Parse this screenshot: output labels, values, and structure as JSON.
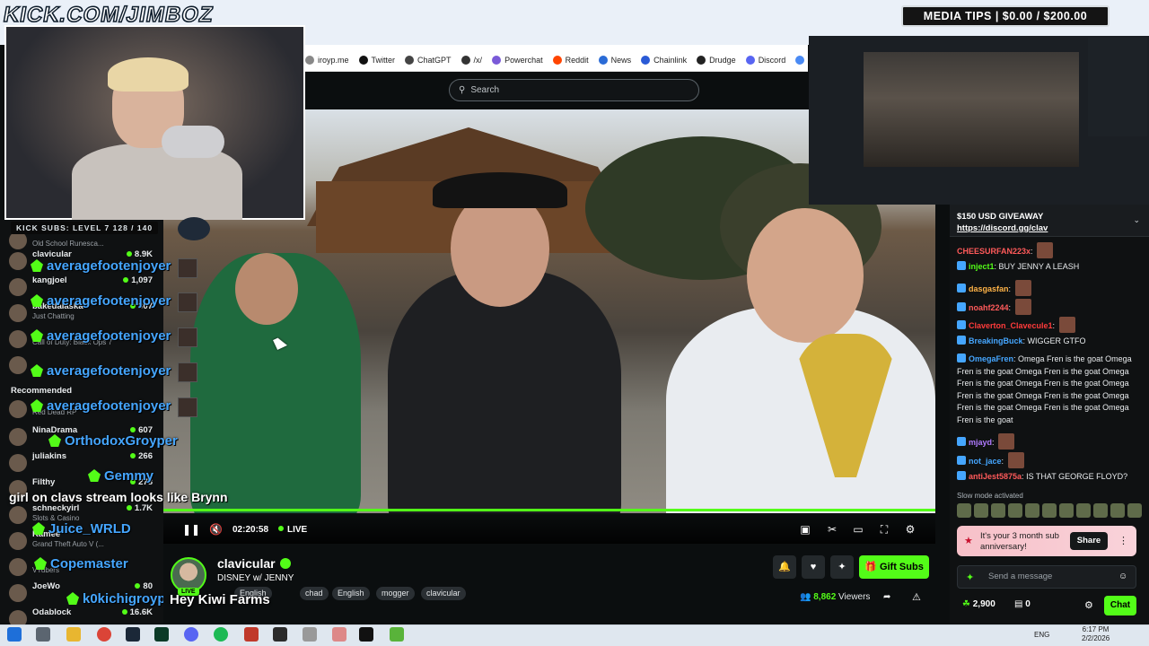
{
  "overlay": {
    "title": "KICK.COM/JIMBOZ",
    "subs_bar": "KICK SUBS: LEVEL 7 128 / 140",
    "media_tips": "MEDIA TIPS | $0.00 / $200.00",
    "caption": "girl on clavs stream looks like Brynn",
    "hey": "Hey Kiwi Farms",
    "chat_users": [
      "averagefootenjoyer",
      "averagefootenjoyer",
      "averagefootenjoyer",
      "averagefootenjoyer",
      "averagefootenjoyer",
      "OrthodoxGroyper",
      "Gemmy",
      "Juice_WRLD",
      "Copemaster",
      "k0kichigroyper"
    ]
  },
  "browser": {
    "bookmarks": [
      {
        "label": "iroyp.me",
        "color": "#888888"
      },
      {
        "label": "Twitter",
        "color": "#111111"
      },
      {
        "label": "ChatGPT",
        "color": "#444444"
      },
      {
        "label": "/x/",
        "color": "#333333"
      },
      {
        "label": "Powerchat",
        "color": "#7a5ad8"
      },
      {
        "label": "Reddit",
        "color": "#ff4500"
      },
      {
        "label": "News",
        "color": "#2a6bd6"
      },
      {
        "label": "Chainlink",
        "color": "#2a5ad6"
      },
      {
        "label": "Drudge",
        "color": "#222222"
      },
      {
        "label": "Discord",
        "color": "#5865f2"
      },
      {
        "label": "Gemini",
        "color": "#4a8af4"
      }
    ]
  },
  "search": {
    "placeholder": "Search"
  },
  "sidebar": {
    "recommended_label": "Recommended",
    "channels": [
      {
        "name": "",
        "game": "Old School Runesca...",
        "viewers": ""
      },
      {
        "name": "clavicular",
        "game": "",
        "viewers": "8.9K"
      },
      {
        "name": "kangjoel",
        "game": "",
        "viewers": "1,097"
      },
      {
        "name": "bakedalaska",
        "game": "Just Chatting",
        "viewers": "307"
      },
      {
        "name": "",
        "game": "Call of Duty: Black Ops 7",
        "viewers": ""
      },
      {
        "name": "",
        "game": "",
        "viewers": ""
      },
      {
        "name": "",
        "game": "Red Dead RP",
        "viewers": ""
      },
      {
        "name": "NinaDrama",
        "game": "",
        "viewers": "607"
      },
      {
        "name": "juliakins",
        "game": "",
        "viewers": "266"
      },
      {
        "name": "Filthy",
        "game": "",
        "viewers": "278"
      },
      {
        "name": "schneckyirl",
        "game": "Slots & Casino",
        "viewers": "1.7K"
      },
      {
        "name": "Ramee",
        "game": "Grand Theft Auto V (...",
        "viewers": ""
      },
      {
        "name": "",
        "game": "VTubers",
        "viewers": ""
      },
      {
        "name": "JoeWo",
        "game": "",
        "viewers": "80"
      },
      {
        "name": "Odablock",
        "game": "",
        "viewers": "16.6K"
      }
    ]
  },
  "player": {
    "time": "02:20:58",
    "live_label": "LIVE",
    "progress": 1.0
  },
  "stream": {
    "live_pill": "LIVE",
    "streamer": "clavicular",
    "title": "DISNEY w/ JENNY",
    "tags": [
      "English",
      "chad",
      "English",
      "mogger",
      "clavicular"
    ],
    "viewers_count": "8,862",
    "viewers_label": "Viewers",
    "gift_label": "Gift Subs"
  },
  "chat": {
    "giveaway_title": "$150 USD GIVEAWAY",
    "giveaway_link": "https://discord.gg/clav",
    "messages": [
      {
        "user": "CHEESURFAN223x",
        "color": "#ff5a5a",
        "text": "",
        "emote": true
      },
      {
        "user": "inject1",
        "color": "#53fc18",
        "text": "BUY JENNY A LEASH",
        "emote": false
      },
      {
        "user": "dasgasfan",
        "color": "#ffb347",
        "text": "",
        "emote": true
      },
      {
        "user": "noahf2244",
        "color": "#ff5a5a",
        "text": "",
        "emote": true
      },
      {
        "user": "Claverton_Clavecule1",
        "color": "#ff3b3b",
        "text": "",
        "emote": true
      },
      {
        "user": "BreakingBuck",
        "color": "#45a6ff",
        "text": "WIGGER GTFO",
        "emote": false
      },
      {
        "user": "OmegaFren",
        "color": "#45a6ff",
        "text": "Omega Fren is the goat Omega Fren is the goat Omega Fren is the goat Omega Fren is the goat Omega Fren is the goat Omega Fren is the goat Omega Fren is the goat Omega Fren is the goat Omega Fren is the goat Omega Fren is the goat",
        "emote": false
      },
      {
        "user": "mjayd",
        "color": "#b07aff",
        "text": "",
        "emote": true
      },
      {
        "user": "not_jace",
        "color": "#45a6ff",
        "text": "",
        "emote": true
      },
      {
        "user": "antiJest5875a",
        "color": "#ff5a5a",
        "text": "IS THAT GEORGE FLOYD?",
        "emote": false
      }
    ],
    "slow_mode": "Slow mode activated",
    "anniversary": "It's your 3 month sub anniversary!",
    "share_label": "Share",
    "send_placeholder": "Send a message",
    "points": "2,900",
    "points2": "0",
    "chat_button": "Chat"
  },
  "taskbar": {
    "lang": "ENG",
    "time": "6:17 PM",
    "date": "2/2/2026"
  },
  "colors": {
    "kick_green": "#53fc18",
    "background": "#0b0e0f"
  }
}
